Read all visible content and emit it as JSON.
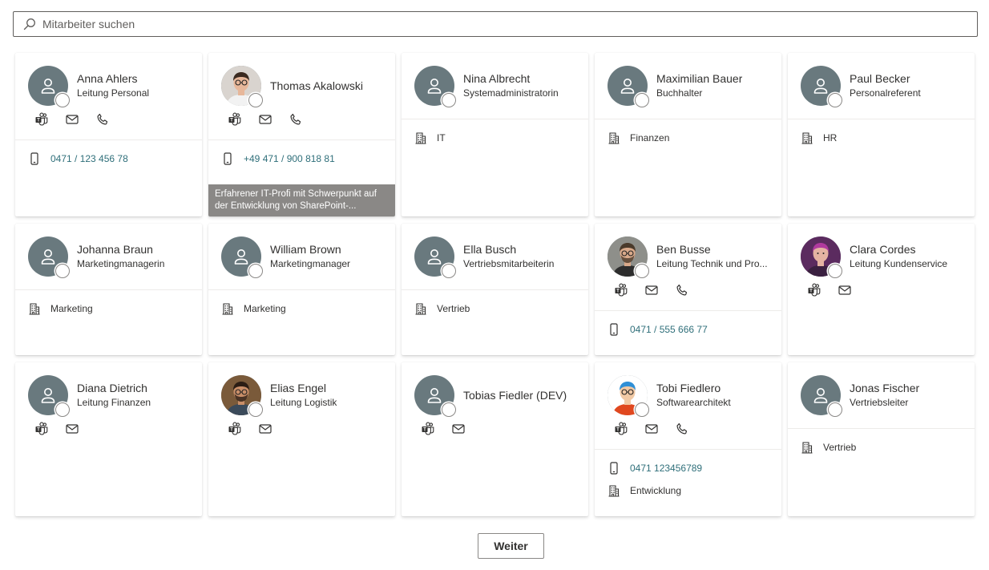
{
  "search": {
    "placeholder": "Mitarbeiter suchen",
    "icon": "search-icon"
  },
  "colors": {
    "avatar_bg": "#69797e",
    "link": "#2f6f7a",
    "tooltip_bg": "#8a8886"
  },
  "cards": [
    {
      "name": "Anna Ahlers",
      "title": "Leitung Personal",
      "actions": [
        "teams",
        "mail",
        "phone"
      ],
      "phone": "0471 / 123 456 78"
    },
    {
      "name": "Thomas Akalowski",
      "title": "",
      "photo": true,
      "actions": [
        "teams",
        "mail",
        "phone"
      ],
      "phone": "+49 471 / 900 818 81",
      "tooltip": [
        "Erfahrener IT-Profi mit Schwerpunkt auf",
        "der Entwicklung von SharePoint-..."
      ]
    },
    {
      "name": "Nina Albrecht",
      "title": "Systemadministratorin",
      "department": "IT"
    },
    {
      "name": "Maximilian Bauer",
      "title": "Buchhalter",
      "department": "Finanzen"
    },
    {
      "name": "Paul Becker",
      "title": "Personalreferent",
      "department": "HR"
    },
    {
      "name": "Johanna Braun",
      "title": "Marketingmanagerin",
      "department": "Marketing"
    },
    {
      "name": "William Brown",
      "title": "Marketingmanager",
      "department": "Marketing"
    },
    {
      "name": "Ella Busch",
      "title": "Vertriebsmitarbeiterin",
      "department": "Vertrieb"
    },
    {
      "name": "Ben Busse",
      "title": "Leitung Technik und Pro...",
      "photo": true,
      "actions": [
        "teams",
        "mail",
        "phone"
      ],
      "phone": "0471 / 555 666 77"
    },
    {
      "name": "Clara Cordes",
      "title": "Leitung Kundenservice",
      "photo": true,
      "actions": [
        "teams",
        "mail"
      ]
    },
    {
      "name": "Diana Dietrich",
      "title": "Leitung Finanzen",
      "actions": [
        "teams",
        "mail"
      ]
    },
    {
      "name": "Elias Engel",
      "title": "Leitung Logistik",
      "photo": true,
      "actions": [
        "teams",
        "mail"
      ]
    },
    {
      "name": "Tobias Fiedler (DEV)",
      "title": "",
      "actions": [
        "teams",
        "mail"
      ]
    },
    {
      "name": "Tobi Fiedlero",
      "title": "Softwarearchitekt",
      "photo": true,
      "actions": [
        "teams",
        "mail",
        "phone"
      ],
      "phone": "0471 123456789",
      "department": "Entwicklung"
    },
    {
      "name": "Jonas Fischer",
      "title": "Vertriebsleiter",
      "department": "Vertrieb"
    }
  ],
  "pager": {
    "next_label": "Weiter"
  }
}
